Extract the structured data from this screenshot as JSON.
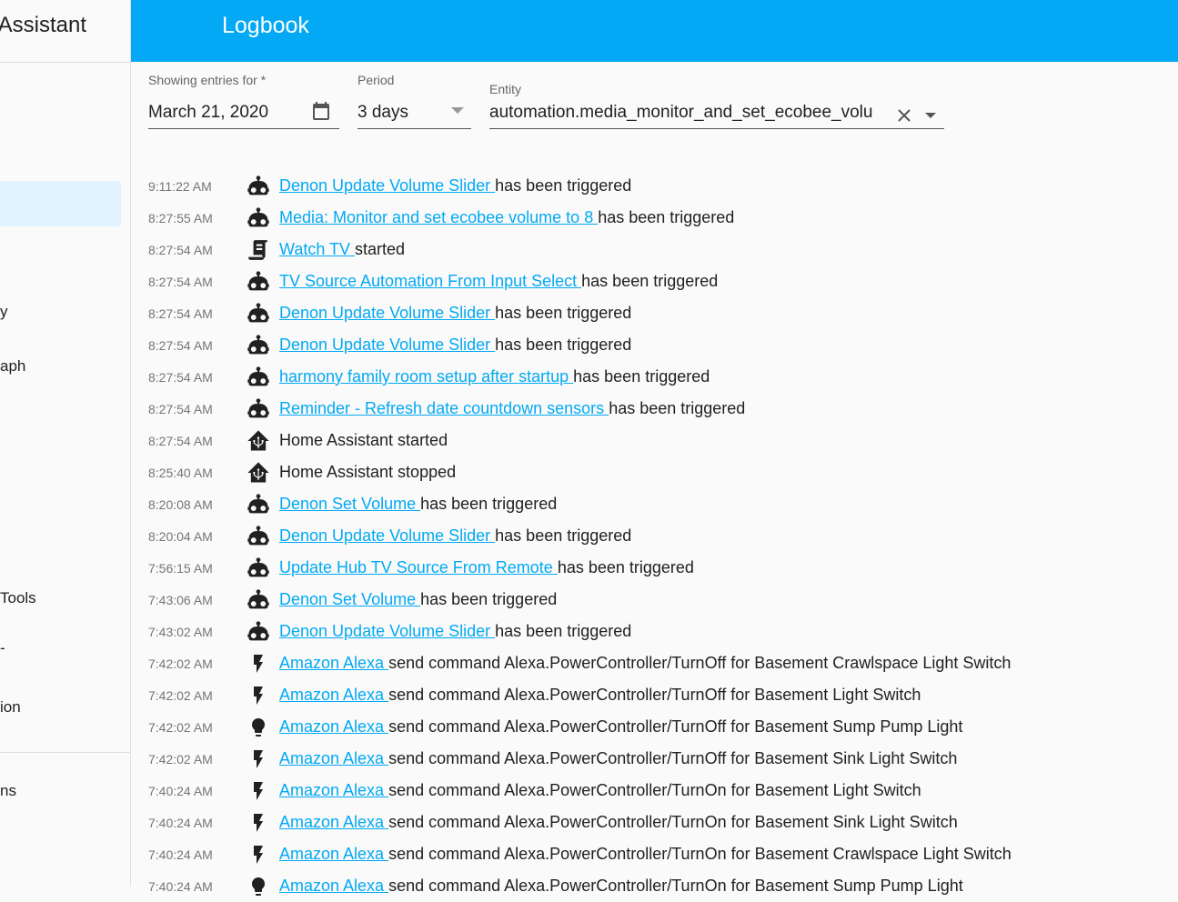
{
  "sidebar": {
    "title": "Assistant",
    "items": [
      "y",
      "aph",
      "Tools",
      "-",
      "ion",
      "ns"
    ]
  },
  "header": {
    "title": "Logbook"
  },
  "filters": {
    "date_label": "Showing entries for *",
    "date_value": "March 21, 2020",
    "period_label": "Period",
    "period_value": "3 days",
    "entity_label": "Entity",
    "entity_value": "automation.media_monitor_and_set_ecobee_volu"
  },
  "colors": {
    "accent": "#03a9f4"
  },
  "entries": [
    {
      "time": "9:11:22 AM",
      "icon": "robot",
      "link": "Denon Update Volume Slider ",
      "msg": "has been triggered"
    },
    {
      "time": "8:27:55 AM",
      "icon": "robot",
      "link": "Media: Monitor and set ecobee volume to 8 ",
      "msg": "has been triggered"
    },
    {
      "time": "8:27:54 AM",
      "icon": "script",
      "link": "Watch TV ",
      "msg": "started"
    },
    {
      "time": "8:27:54 AM",
      "icon": "robot",
      "link": "TV Source Automation From Input Select ",
      "msg": "has been triggered"
    },
    {
      "time": "8:27:54 AM",
      "icon": "robot",
      "link": "Denon Update Volume Slider ",
      "msg": "has been triggered"
    },
    {
      "time": "8:27:54 AM",
      "icon": "robot",
      "link": "Denon Update Volume Slider ",
      "msg": "has been triggered"
    },
    {
      "time": "8:27:54 AM",
      "icon": "robot",
      "link": "harmony family room setup after startup ",
      "msg": "has been triggered"
    },
    {
      "time": "8:27:54 AM",
      "icon": "robot",
      "link": "Reminder - Refresh date countdown sensors ",
      "msg": "has been triggered"
    },
    {
      "time": "8:27:54 AM",
      "icon": "home-assistant",
      "link": "",
      "msg": "Home Assistant started"
    },
    {
      "time": "8:25:40 AM",
      "icon": "home-assistant",
      "link": "",
      "msg": "Home Assistant stopped"
    },
    {
      "time": "8:20:08 AM",
      "icon": "robot",
      "link": "Denon Set Volume ",
      "msg": "has been triggered"
    },
    {
      "time": "8:20:04 AM",
      "icon": "robot",
      "link": "Denon Update Volume Slider ",
      "msg": "has been triggered"
    },
    {
      "time": "7:56:15 AM",
      "icon": "robot",
      "link": "Update Hub TV Source From Remote ",
      "msg": "has been triggered"
    },
    {
      "time": "7:43:06 AM",
      "icon": "robot",
      "link": "Denon Set Volume ",
      "msg": "has been triggered"
    },
    {
      "time": "7:43:02 AM",
      "icon": "robot",
      "link": "Denon Update Volume Slider ",
      "msg": "has been triggered"
    },
    {
      "time": "7:42:02 AM",
      "icon": "flash",
      "link": "Amazon Alexa ",
      "msg": "send command Alexa.PowerController/TurnOff for Basement Crawlspace Light Switch"
    },
    {
      "time": "7:42:02 AM",
      "icon": "flash",
      "link": "Amazon Alexa ",
      "msg": "send command Alexa.PowerController/TurnOff for Basement Light Switch"
    },
    {
      "time": "7:42:02 AM",
      "icon": "lightbulb",
      "link": "Amazon Alexa ",
      "msg": "send command Alexa.PowerController/TurnOff for Basement Sump Pump Light"
    },
    {
      "time": "7:42:02 AM",
      "icon": "flash",
      "link": "Amazon Alexa ",
      "msg": "send command Alexa.PowerController/TurnOff for Basement Sink Light Switch"
    },
    {
      "time": "7:40:24 AM",
      "icon": "flash",
      "link": "Amazon Alexa ",
      "msg": "send command Alexa.PowerController/TurnOn for Basement Light Switch"
    },
    {
      "time": "7:40:24 AM",
      "icon": "flash",
      "link": "Amazon Alexa ",
      "msg": "send command Alexa.PowerController/TurnOn for Basement Sink Light Switch"
    },
    {
      "time": "7:40:24 AM",
      "icon": "flash",
      "link": "Amazon Alexa ",
      "msg": "send command Alexa.PowerController/TurnOn for Basement Crawlspace Light Switch"
    },
    {
      "time": "7:40:24 AM",
      "icon": "lightbulb",
      "link": "Amazon Alexa ",
      "msg": "send command Alexa.PowerController/TurnOn for Basement Sump Pump Light"
    }
  ]
}
